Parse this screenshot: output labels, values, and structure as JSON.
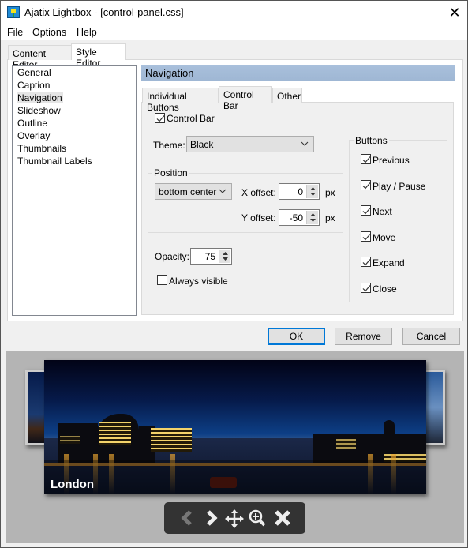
{
  "window": {
    "title": "Ajatix Lightbox - [control-panel.css]",
    "icon": "app-icon"
  },
  "menu": [
    "File",
    "Options",
    "Help"
  ],
  "main_tabs": [
    {
      "label": "Content Editor",
      "active": false
    },
    {
      "label": "Style Editor",
      "active": true
    }
  ],
  "sidebar": {
    "items": [
      "General",
      "Caption",
      "Navigation",
      "Slideshow",
      "Outline",
      "Overlay",
      "Thumbnails",
      "Thumbnail Labels"
    ],
    "selected": "Navigation"
  },
  "section_header": "Navigation",
  "sub_tabs": [
    {
      "label": "Individual Buttons",
      "active": false
    },
    {
      "label": "Control Bar",
      "active": true
    },
    {
      "label": "Other",
      "active": false
    }
  ],
  "control_bar": {
    "enabled_label": "Control Bar",
    "enabled": true,
    "theme_label": "Theme:",
    "theme_value": "Black",
    "position": {
      "group_label": "Position",
      "anchor_value": "bottom center",
      "x_offset_label": "X offset:",
      "x_offset": "0",
      "y_offset_label": "Y offset:",
      "y_offset": "-50",
      "unit": "px"
    },
    "opacity_label": "Opacity:",
    "opacity": "75",
    "always_visible_label": "Always visible",
    "always_visible": false,
    "buttons": {
      "group_label": "Buttons",
      "items": [
        {
          "label": "Previous",
          "checked": true
        },
        {
          "label": "Play / Pause",
          "checked": true
        },
        {
          "label": "Next",
          "checked": true
        },
        {
          "label": "Move",
          "checked": true
        },
        {
          "label": "Expand",
          "checked": true
        },
        {
          "label": "Close",
          "checked": true
        }
      ]
    }
  },
  "dialog_buttons": {
    "ok": "OK",
    "remove": "Remove",
    "cancel": "Cancel"
  },
  "preview": {
    "caption": "London",
    "controls": [
      "previous-icon",
      "next-icon",
      "move-icon",
      "zoom-in-icon",
      "close-icon"
    ]
  },
  "colors": {
    "header": "#a9c0dc",
    "focus": "#0078d7",
    "preview_bg": "#b4b4b4",
    "control_bar": "#333333"
  }
}
